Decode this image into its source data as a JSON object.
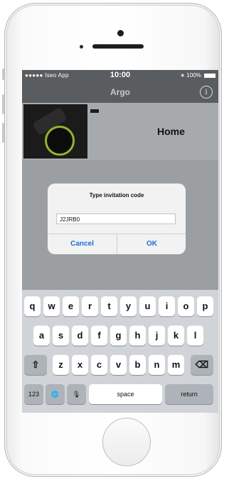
{
  "status_bar": {
    "carrier": "●●●●● Iseo App",
    "time": "10:00",
    "battery": "100%"
  },
  "navbar": {
    "title": "Argo",
    "info_icon": "info-icon"
  },
  "device": {
    "name": "Home"
  },
  "dialog": {
    "title": "Type invitation code",
    "input_value": "J2JRB0",
    "cancel": "Cancel",
    "ok": "OK"
  },
  "keyboard": {
    "row1": [
      "q",
      "w",
      "e",
      "r",
      "t",
      "y",
      "u",
      "i",
      "o",
      "p"
    ],
    "row2": [
      "a",
      "s",
      "d",
      "f",
      "g",
      "h",
      "j",
      "k",
      "l"
    ],
    "row3": [
      "z",
      "x",
      "c",
      "v",
      "b",
      "n",
      "m"
    ],
    "shift": "⇧",
    "backspace": "⌫",
    "numbers": "123",
    "globe": "🌐",
    "mic": "🎙",
    "space": "space",
    "return": "return"
  },
  "colors": {
    "accent": "#1a6fd8",
    "navbar": "#5a5d60"
  }
}
